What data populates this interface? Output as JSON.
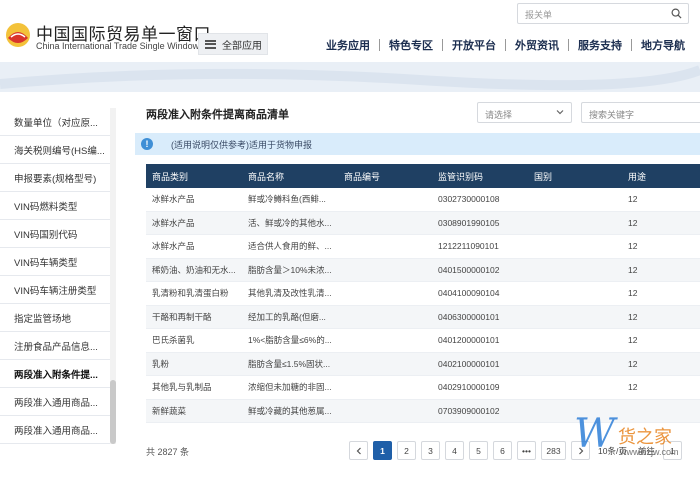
{
  "header": {
    "logo_cn": "中国国际贸易单一窗口",
    "logo_en": "China International Trade Single Window",
    "all_apps_label": "全部应用",
    "search_placeholder": "报关单",
    "nav": [
      "业务应用",
      "特色专区",
      "开放平台",
      "外贸资讯",
      "服务支持",
      "地方导航"
    ]
  },
  "sidebar": {
    "items": [
      {
        "label": "数量单位（对应原...",
        "active": false
      },
      {
        "label": "海关税则编号(HS编...",
        "active": false
      },
      {
        "label": "申报要素(规格型号)",
        "active": false
      },
      {
        "label": "VIN码燃料类型",
        "active": false
      },
      {
        "label": "VIN码国别代码",
        "active": false
      },
      {
        "label": "VIN码车辆类型",
        "active": false
      },
      {
        "label": "VIN码车辆注册类型",
        "active": false
      },
      {
        "label": "指定监管场地",
        "active": false
      },
      {
        "label": "注册食品产品信息...",
        "active": false
      },
      {
        "label": "两段准入附条件提...",
        "active": true
      },
      {
        "label": "两段准入通用商品...",
        "active": false
      },
      {
        "label": "两段准入通用商品...",
        "active": false
      }
    ]
  },
  "main": {
    "title": "两段准入附条件提离商品清单",
    "select_placeholder": "请选择",
    "keyword_placeholder": "搜索关键字",
    "notice": "(适用说明仅供参考)适用于货物申报"
  },
  "table": {
    "headers": [
      "商品类别",
      "商品名称",
      "商品编号",
      "监管识别码",
      "国别",
      "用途"
    ],
    "rows": [
      [
        "冰鲜水产品",
        "鲜或冷鳟科鱼(西鲱...",
        "",
        "0302730000108",
        "",
        "12"
      ],
      [
        "冰鲜水产品",
        "活、鲜或冷的其他水...",
        "",
        "0308901990105",
        "",
        "12"
      ],
      [
        "冰鲜水产品",
        "适合供人食用的鲜、...",
        "",
        "1212211090101",
        "",
        "12"
      ],
      [
        "稀奶油、奶油和无水...",
        "脂肪含量＞10%未浓...",
        "",
        "0401500000102",
        "",
        "12"
      ],
      [
        "乳清粉和乳清蛋白粉",
        "其他乳清及改性乳清...",
        "",
        "0404100090104",
        "",
        "12"
      ],
      [
        "干酪和再制干酪",
        "经加工的乳酪(但磨...",
        "",
        "0406300000101",
        "",
        "12"
      ],
      [
        "巴氏杀菌乳",
        "1%<脂肪含量≤6%的...",
        "",
        "0401200000101",
        "",
        "12"
      ],
      [
        "乳粉",
        "脂肪含量≤1.5%固状...",
        "",
        "0402100000101",
        "",
        "12"
      ],
      [
        "其他乳与乳制品",
        "浓缩但未加糖的非固...",
        "",
        "0402910000109",
        "",
        "12"
      ],
      [
        "新鲜蔬菜",
        "鲜或冷藏的其他葱属...",
        "",
        "0703909000102",
        "",
        ""
      ]
    ]
  },
  "pagination": {
    "total": "共 2827 条",
    "pages": [
      "1",
      "2",
      "3",
      "4",
      "5",
      "6",
      "•••",
      "283"
    ],
    "current": "1",
    "page_size": "10条/页",
    "goto": "前往",
    "goto_value": "1"
  },
  "watermark": {
    "cn": "货之家",
    "url": "www.hzjw.com"
  },
  "colors": {
    "table_header": "#1f4063",
    "notice_bg": "#d9ecfb",
    "pager_current": "#1f5fa8"
  }
}
